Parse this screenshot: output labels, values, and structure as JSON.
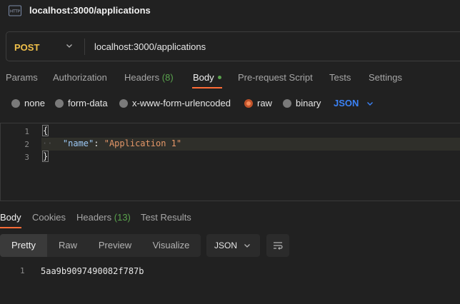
{
  "window": {
    "icon_label": "HTTP",
    "title": "localhost:3000/applications"
  },
  "request": {
    "method": "POST",
    "url": "localhost:3000/applications"
  },
  "request_tabs": {
    "params": "Params",
    "authorization": "Authorization",
    "headers": "Headers",
    "headers_count": "(8)",
    "body": "Body",
    "pre_request": "Pre-request Script",
    "tests": "Tests",
    "settings": "Settings",
    "active": "Body"
  },
  "body_types": {
    "none": "none",
    "form_data": "form-data",
    "urlencoded": "x-www-form-urlencoded",
    "raw": "raw",
    "binary": "binary",
    "selected": "raw",
    "format": "JSON"
  },
  "editor": {
    "line_numbers": [
      "1",
      "2",
      "3"
    ],
    "line1": "{",
    "line2_key": "\"name\"",
    "line2_colon": ": ",
    "line2_value": "\"Application 1\"",
    "line3": "}"
  },
  "response_tabs": {
    "body": "Body",
    "cookies": "Cookies",
    "headers": "Headers",
    "headers_count": "(13)",
    "test_results": "Test Results",
    "active": "Body"
  },
  "response_view": {
    "pretty": "Pretty",
    "raw": "Raw",
    "preview": "Preview",
    "visualize": "Visualize",
    "active": "Pretty",
    "format": "JSON"
  },
  "response": {
    "line_number": "1",
    "value": "5aa9b9097490082f787b"
  },
  "colors": {
    "accent": "#ff6c37",
    "method": "#f0c04a",
    "json_link": "#3b82f6",
    "count": "#5aa34d",
    "background": "#212121"
  },
  "icons": [
    "http-icon",
    "chevron-down-icon",
    "wrap-lines-icon"
  ]
}
